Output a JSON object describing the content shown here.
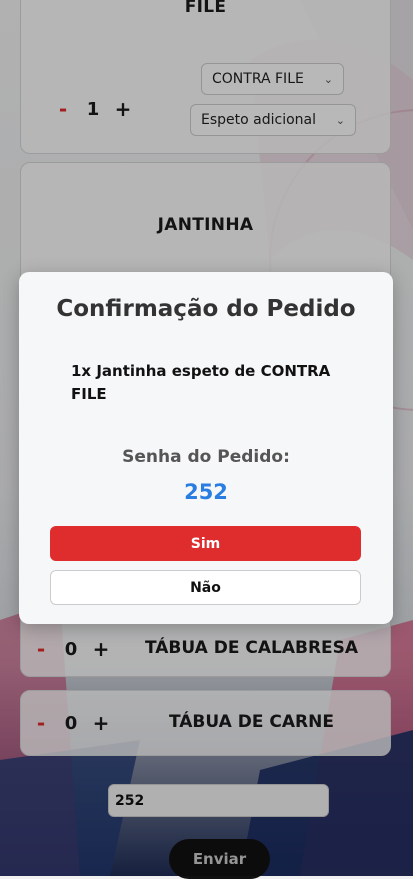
{
  "cards": {
    "file": {
      "title": "FILE",
      "qty": "1",
      "minus": "-",
      "plus": "+",
      "cut_select": "CONTRA FILE",
      "extra_select": "Espeto adicional"
    },
    "jantinha": {
      "title": "JANTINHA"
    },
    "calabresa": {
      "title": "TÁBUA DE CALABRESA",
      "qty": "0",
      "minus": "-",
      "plus": "+"
    },
    "carne": {
      "title": "TÁBUA DE CARNE",
      "qty": "0",
      "minus": "-",
      "plus": "+"
    }
  },
  "modal": {
    "title": "Confirmação do Pedido",
    "item": "1x Jantinha espeto de CONTRA FILE",
    "code_label": "Senha do Pedido:",
    "code": "252",
    "yes_label": "Sim",
    "no_label": "Não"
  },
  "order": {
    "code_value": "252",
    "send_label": "Enviar"
  },
  "colors": {
    "accent_red": "#df2c2c",
    "code_blue": "#2a7de1"
  }
}
